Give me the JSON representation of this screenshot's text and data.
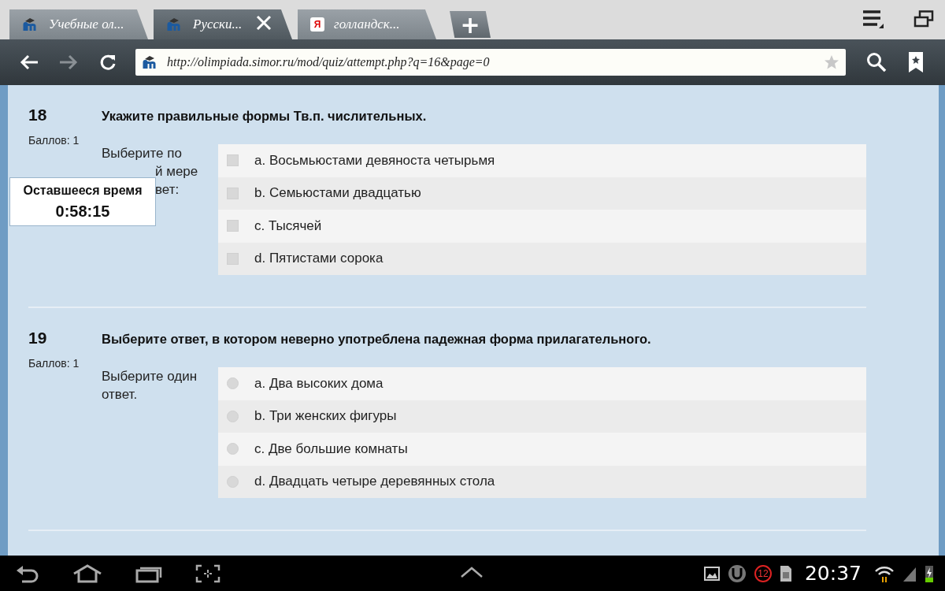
{
  "browser": {
    "tabs": [
      {
        "title": "Учебные ол...",
        "selected": false,
        "kind": "moodle"
      },
      {
        "title": "Русски...",
        "selected": true,
        "kind": "moodle"
      },
      {
        "title": "голландск...",
        "selected": false,
        "kind": "yandex",
        "favicon_text": "Я"
      }
    ],
    "new_tab": "+",
    "url": "http://olimpiada.simor.ru/mod/quiz/attempt.php?q=16&page=0"
  },
  "questions": [
    {
      "number": "18",
      "grade": "Баллов: 1",
      "text": "Укажите правильные формы Тв.п. числительных.",
      "prompt_lines": [
        {
          "text": "Выберите по",
          "covered": false
        },
        {
          "text": "й мере",
          "covered": true
        },
        {
          "text": "вет:",
          "covered": true
        }
      ],
      "kind": "checkbox",
      "options": [
        {
          "label": "a. Восьмьюстами девяноста четырьмя",
          "checked": false
        },
        {
          "label": "b. Семьюстами двадцатью",
          "checked": false
        },
        {
          "label": "c. Тысячей",
          "checked": false
        },
        {
          "label": "d. Пятистами сорока",
          "checked": false
        }
      ]
    },
    {
      "number": "19",
      "grade": "Баллов: 1",
      "text": "Выберите ответ, в котором неверно употреблена падежная форма прилагательного.",
      "prompt_lines": [
        {
          "text": "Выберите один",
          "covered": false
        },
        {
          "text": "ответ.",
          "covered": false
        }
      ],
      "kind": "radio",
      "options": [
        {
          "label": "a. Два высоких дома",
          "checked": false
        },
        {
          "label": "b. Три женских фигуры",
          "checked": false
        },
        {
          "label": "c. Две большие комнаты",
          "checked": false
        },
        {
          "label": "d. Двадцать четыре деревянных стола",
          "checked": false
        }
      ]
    }
  ],
  "timer": {
    "title": "Оставшееся время",
    "value": "0:58:15"
  },
  "status_bar": {
    "notification_count": "12",
    "time": "20:37"
  }
}
